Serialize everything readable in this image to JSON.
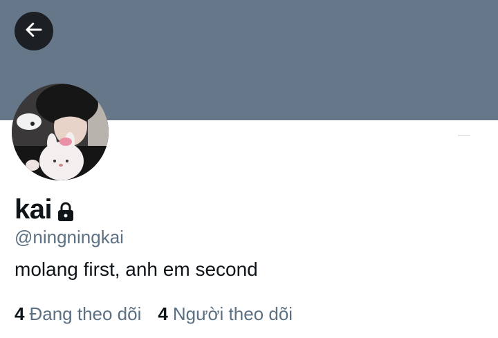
{
  "header": {
    "banner_color": "#66778a",
    "back_button": {
      "icon": "arrow-left-icon"
    }
  },
  "profile": {
    "avatar": {
      "icon": "profile-photo"
    },
    "display_name": "kai",
    "protected_icon": "lock-icon",
    "handle": "@ningningkai",
    "bio": "molang first, anh em second"
  },
  "stats": {
    "following": {
      "count": "4",
      "label": "Đang theo dõi"
    },
    "followers": {
      "count": "4",
      "label": "Người theo dõi"
    }
  },
  "colors": {
    "text_primary": "#0f1419",
    "text_secondary": "#5b7083",
    "back_button_bg": "#1c1f23"
  }
}
